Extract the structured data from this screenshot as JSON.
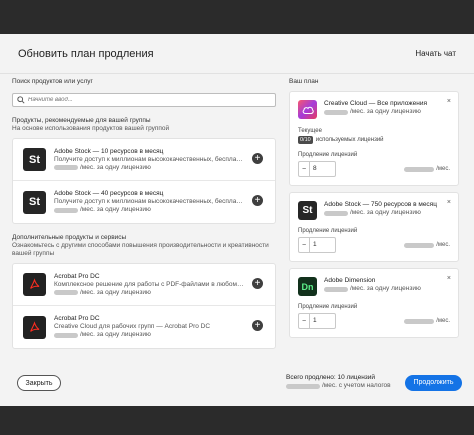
{
  "header": {
    "title": "Обновить план продления",
    "chat": "Начать чат"
  },
  "search": {
    "label": "Поиск продуктов или услуг",
    "placeholder": "Начните ввод..."
  },
  "recommended": {
    "heading": "Продукты, рекомендуемые для вашей группы",
    "subheading": "На основе использования продуктов вашей группой",
    "items": [
      {
        "icon": "St",
        "name": "Adobe Stock — 10 ресурсов в месяц",
        "desc": "Получите доступ к миллионам высококачественных, бесплатных...",
        "price": "/мес. за одну лицензию"
      },
      {
        "icon": "St",
        "name": "Adobe Stock — 40 ресурсов в месяц",
        "desc": "Получите доступ к миллионам высококачественных, бесплатных...",
        "price": "/мес. за одну лицензию"
      }
    ]
  },
  "additional": {
    "heading": "Дополнительные продукты и сервисы",
    "subheading": "Ознакомьтесь с другими способами повышения производительности и креативности вашей группы",
    "items": [
      {
        "icon": "pdf-icon",
        "name": "Acrobat Pro DC",
        "desc": "Комплексное решение для работы с PDF-файлами в любом месте",
        "price": "/мес. за одну лицензию"
      },
      {
        "icon": "pdf-icon",
        "name": "Acrobat Pro DC",
        "desc": "Creative Cloud для рабочих групп — Acrobat Pro DC",
        "price": "/мес. за одну лицензию"
      }
    ]
  },
  "plan": {
    "heading": "Ваш план",
    "cards": [
      {
        "name": "Creative Cloud — Все приложения",
        "price": "/мес. за одну лицензию",
        "current_label": "Текущее",
        "current_badge": "0/10",
        "current_text": "используемых лицензий",
        "qty_label": "Продление лицензий",
        "qty": "8",
        "per": "/мес."
      },
      {
        "icon": "St",
        "name": "Adobe Stock — 750 ресурсов в месяц",
        "price": "/мес. за одну лицензию",
        "qty_label": "Продление лицензий",
        "qty": "1",
        "per": "/мес."
      },
      {
        "icon": "Dn",
        "name": "Adobe Dimension",
        "price": "/мес. за одну лицензию",
        "qty_label": "Продление лицензий",
        "qty": "1",
        "per": "/мес."
      }
    ]
  },
  "footer": {
    "close": "Закрыть",
    "total_line1": "Всего продлено: 10 лицензий",
    "total_line2": "/мес. с учетом налогов",
    "continue": "Продолжить"
  },
  "icons": {
    "plus": "+",
    "minus": "−",
    "close": "×"
  },
  "colors": {
    "primary": "#1473e6",
    "background": "#f3f3f3"
  }
}
